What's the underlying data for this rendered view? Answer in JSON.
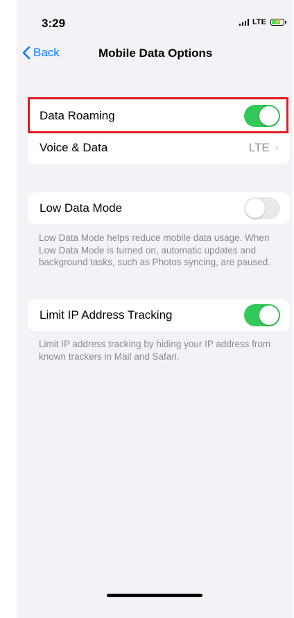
{
  "status_bar": {
    "time": "3:29",
    "network": "LTE",
    "battery_charging": true
  },
  "nav": {
    "back_label": "Back",
    "title": "Mobile Data Options"
  },
  "group1": {
    "data_roaming": {
      "label": "Data Roaming",
      "enabled": true
    },
    "voice_data": {
      "label": "Voice & Data",
      "value": "LTE"
    }
  },
  "group2": {
    "low_data_mode": {
      "label": "Low Data Mode",
      "enabled": false
    },
    "footnote": "Low Data Mode helps reduce mobile data usage. When Low Data Mode is turned on, automatic updates and background tasks, such as Photos syncing, are paused."
  },
  "group3": {
    "limit_ip": {
      "label": "Limit IP Address Tracking",
      "enabled": true
    },
    "footnote": "Limit IP address tracking by hiding your IP address from known trackers in Mail and Safari."
  },
  "colors": {
    "accent": "#007aff",
    "toggle_on": "#34c759",
    "toggle_off": "#e9e9ea",
    "highlight": "#e01b24",
    "background": "#f2f2f7"
  }
}
